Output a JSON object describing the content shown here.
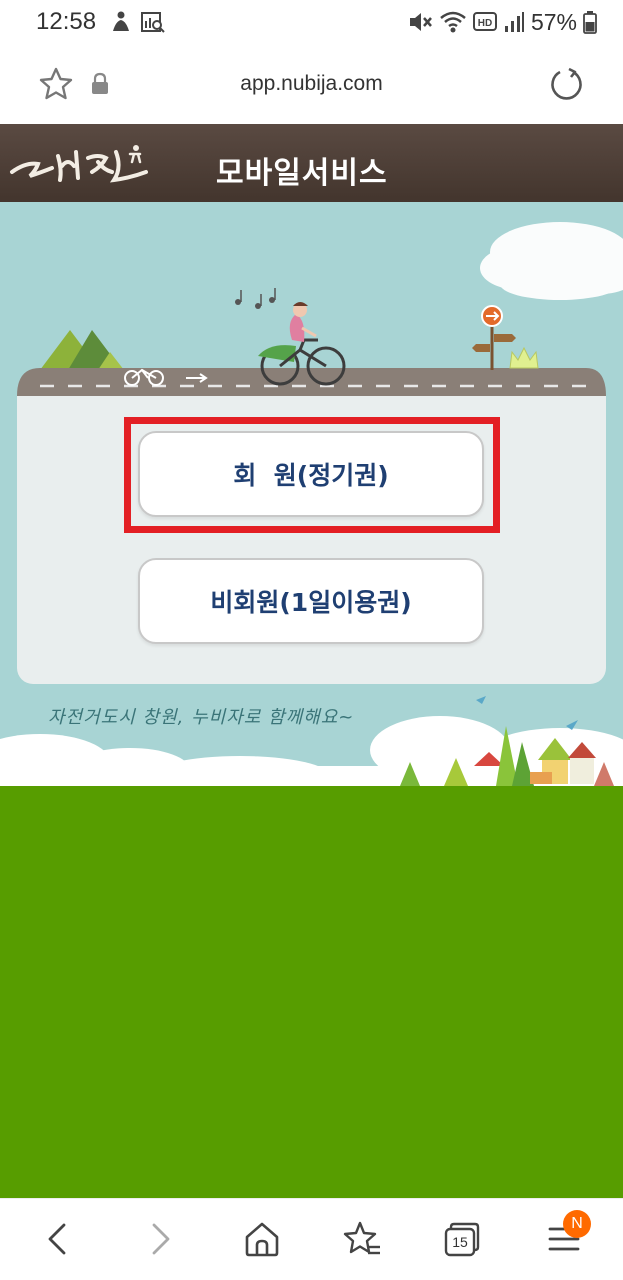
{
  "status_bar": {
    "time": "12:58",
    "battery_percent": "57%",
    "network_type": "HD",
    "icons": [
      "person-icon",
      "search-chart-icon",
      "mute-icon",
      "wifi-icon",
      "hd-icon",
      "signal-icon",
      "battery-icon"
    ]
  },
  "browser": {
    "url": "app.nubija.com",
    "tab_count": "15",
    "menu_badge": "N",
    "icons": [
      "star-icon",
      "lock-icon",
      "reload-icon",
      "back-icon",
      "forward-icon",
      "home-icon",
      "bookmarks-icon",
      "tabs-icon",
      "menu-icon"
    ]
  },
  "site": {
    "logo_text": "누비자",
    "title": "모바일서비스"
  },
  "buttons": {
    "member": "회  원(정기권)",
    "nonmember": "비회원(1일이용권)"
  },
  "slogan": "자전거도시 창원, 누비자로 함께해요~",
  "colors": {
    "header_bg": "#4e3f37",
    "sky": "#a8d4d4",
    "grass": "#579d00",
    "button_text": "#1f3f72",
    "highlight": "#e31f24",
    "badge": "#ff6a00"
  }
}
